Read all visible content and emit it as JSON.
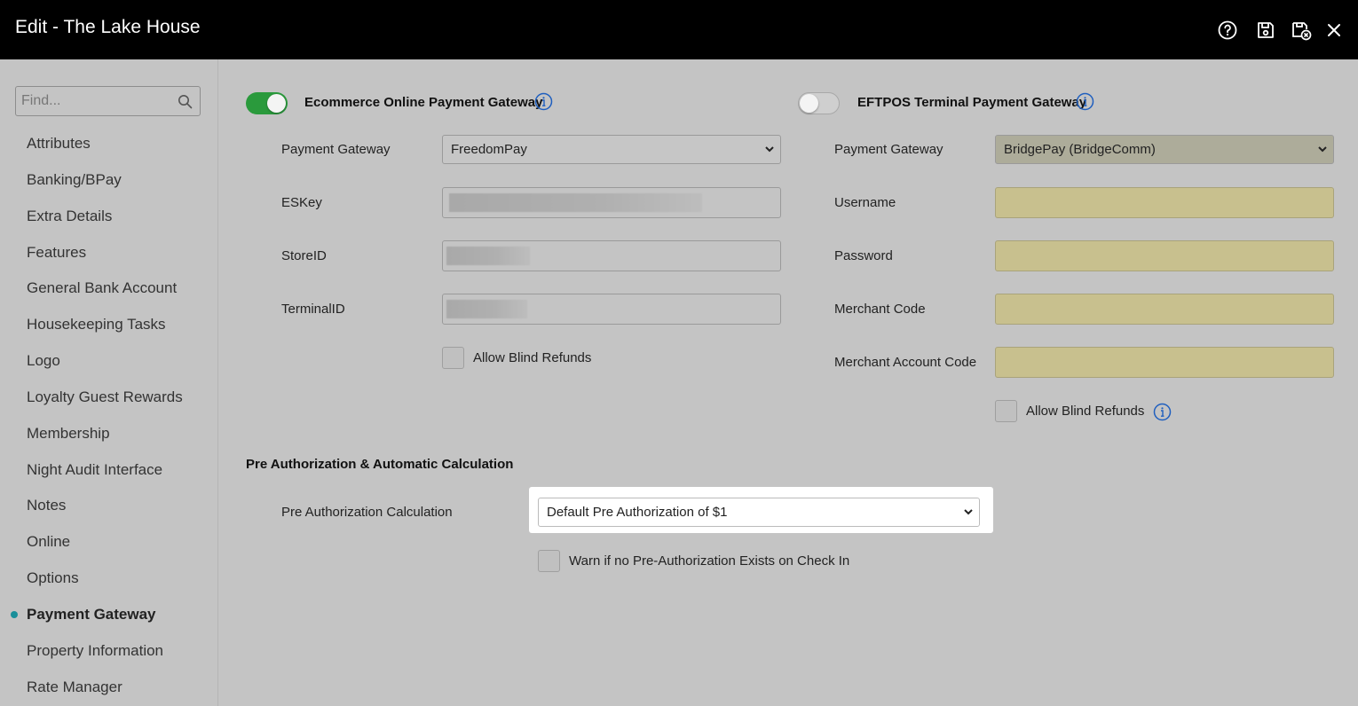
{
  "window": {
    "title": "Edit - The Lake House"
  },
  "toolbar_icons": [
    "help-icon",
    "save-icon",
    "save-close-icon",
    "close-icon"
  ],
  "sidebar": {
    "search_placeholder": "Find...",
    "items": [
      {
        "label": "Attributes"
      },
      {
        "label": "Banking/BPay"
      },
      {
        "label": "Extra Details"
      },
      {
        "label": "Features"
      },
      {
        "label": "General Bank Account"
      },
      {
        "label": "Housekeeping Tasks"
      },
      {
        "label": "Logo"
      },
      {
        "label": "Loyalty Guest Rewards"
      },
      {
        "label": "Membership"
      },
      {
        "label": "Night Audit Interface"
      },
      {
        "label": "Notes"
      },
      {
        "label": "Online"
      },
      {
        "label": "Options"
      },
      {
        "label": "Payment Gateway",
        "active": true
      },
      {
        "label": "Property Information"
      },
      {
        "label": "Rate Manager"
      }
    ]
  },
  "ecommerce": {
    "title": "Ecommerce Online Payment Gateway",
    "enabled": true,
    "gateway_label": "Payment Gateway",
    "gateway_value": "FreedomPay",
    "eskey_label": "ESKey",
    "storeid_label": "StoreID",
    "terminalid_label": "TerminalID",
    "allow_blind_refunds_label": "Allow Blind Refunds",
    "allow_blind_refunds_checked": false
  },
  "eftpos": {
    "title": "EFTPOS Terminal Payment Gateway",
    "enabled": false,
    "gateway_label": "Payment Gateway",
    "gateway_value": "BridgePay (BridgeComm)",
    "username_label": "Username",
    "password_label": "Password",
    "merchant_code_label": "Merchant Code",
    "merchant_account_code_label": "Merchant Account Code",
    "allow_blind_refunds_label": "Allow Blind Refunds",
    "allow_blind_refunds_checked": false
  },
  "preauth": {
    "section_title": "Pre Authorization & Automatic Calculation",
    "calc_label": "Pre Authorization Calculation",
    "calc_value": "Default Pre Authorization of $1",
    "warn_label": "Warn if no Pre-Authorization Exists on Check In",
    "warn_checked": false
  },
  "colors": {
    "titlebar": "#000000",
    "background": "#c4c4c4",
    "toggle_on": "#2a9a3c",
    "info_icon": "#1f5fbf",
    "active_dot": "#1a8f9a",
    "required_field": "#c8c08e"
  }
}
